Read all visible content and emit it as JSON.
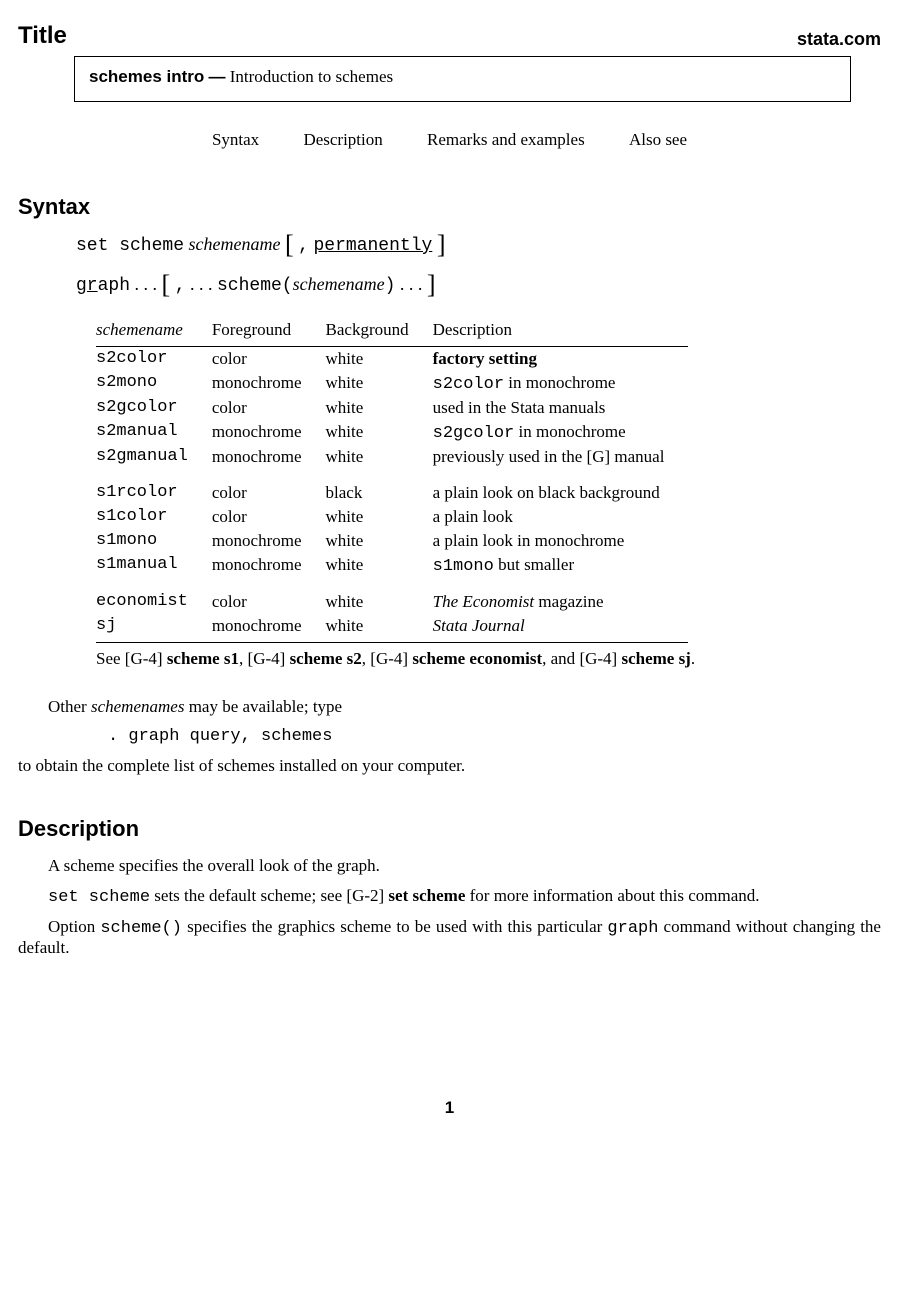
{
  "header": {
    "title": "Title",
    "brand": "stata.com"
  },
  "titlebox": {
    "name": "schemes intro",
    "dash": "—",
    "desc": "Introduction to schemes"
  },
  "nav": {
    "a": "Syntax",
    "b": "Description",
    "c": "Remarks and examples",
    "d": "Also see"
  },
  "sections": {
    "syntax": "Syntax",
    "description": "Description"
  },
  "syntax1": {
    "cmd": "set scheme",
    "arg": "schemename",
    "lb": "[",
    "comma": ",",
    "opt": "permanently",
    "rb": "]"
  },
  "syntax2": {
    "cmd": "graph",
    "cmd_u": "gr",
    "dots1": ". . .",
    "lb": "[",
    "comma": ",",
    "dots2": ". . .",
    "fn": "scheme(",
    "arg": "schemename",
    "fn2": ")",
    "dots3": ". . .",
    "rb": "]"
  },
  "table": {
    "h1": "schemename",
    "h2": "Foreground",
    "h3": "Background",
    "h4": "Description",
    "rows": [
      {
        "n": "s2color",
        "fg": "color",
        "bg": "white",
        "d_bold": "factory setting"
      },
      {
        "n": "s2mono",
        "fg": "monochrome",
        "bg": "white",
        "d_pre": "s2color",
        "d_post": " in monochrome"
      },
      {
        "n": "s2gcolor",
        "fg": "color",
        "bg": "white",
        "d": "used in the Stata manuals"
      },
      {
        "n": "s2manual",
        "fg": "monochrome",
        "bg": "white",
        "d_pre": "s2gcolor",
        "d_post": " in monochrome"
      },
      {
        "n": "s2gmanual",
        "fg": "monochrome",
        "bg": "white",
        "d": "previously used in the [G] manual"
      },
      {
        "n": "s1rcolor",
        "fg": "color",
        "bg": "black",
        "d": "a plain look on black background",
        "gap": true
      },
      {
        "n": "s1color",
        "fg": "color",
        "bg": "white",
        "d": "a plain look"
      },
      {
        "n": "s1mono",
        "fg": "monochrome",
        "bg": "white",
        "d": "a plain look in monochrome"
      },
      {
        "n": "s1manual",
        "fg": "monochrome",
        "bg": "white",
        "d_pre": "s1mono",
        "d_post": " but smaller"
      },
      {
        "n": "economist",
        "fg": "color",
        "bg": "white",
        "d_it": "The Economist",
        "d_post": " magazine",
        "gap": true
      },
      {
        "n": "sj",
        "fg": "monochrome",
        "bg": "white",
        "d_it": "Stata Journal",
        "last": true
      }
    ]
  },
  "footnote": {
    "see": "See ",
    "g4a": "[G-4]",
    "s1": " scheme s1",
    "c": ", ",
    "g4b": "[G-4]",
    "s2": " scheme s2",
    "g4c": "[G-4]",
    "se": " scheme economist",
    "and": ", and ",
    "g4d": "[G-4]",
    "sj": " scheme sj",
    "dot": "."
  },
  "after": {
    "line1a": "Other ",
    "line1b": "schemenames",
    "line1c": " may be available; type",
    "cmd": ". graph query, schemes",
    "line2": "to obtain the complete list of schemes installed on your computer."
  },
  "desc": {
    "p1": "A scheme specifies the overall look of the graph.",
    "p2a": "set scheme",
    "p2b": " sets the default scheme; see ",
    "p2ref": "[G-2]",
    "p2c": " set scheme",
    "p2d": " for more information about this command.",
    "p3a": "Option ",
    "p3b": "scheme()",
    "p3c": " specifies the graphics scheme to be used with this particular ",
    "p3d": "graph",
    "p3e": " command without changing the default."
  },
  "page": "1"
}
